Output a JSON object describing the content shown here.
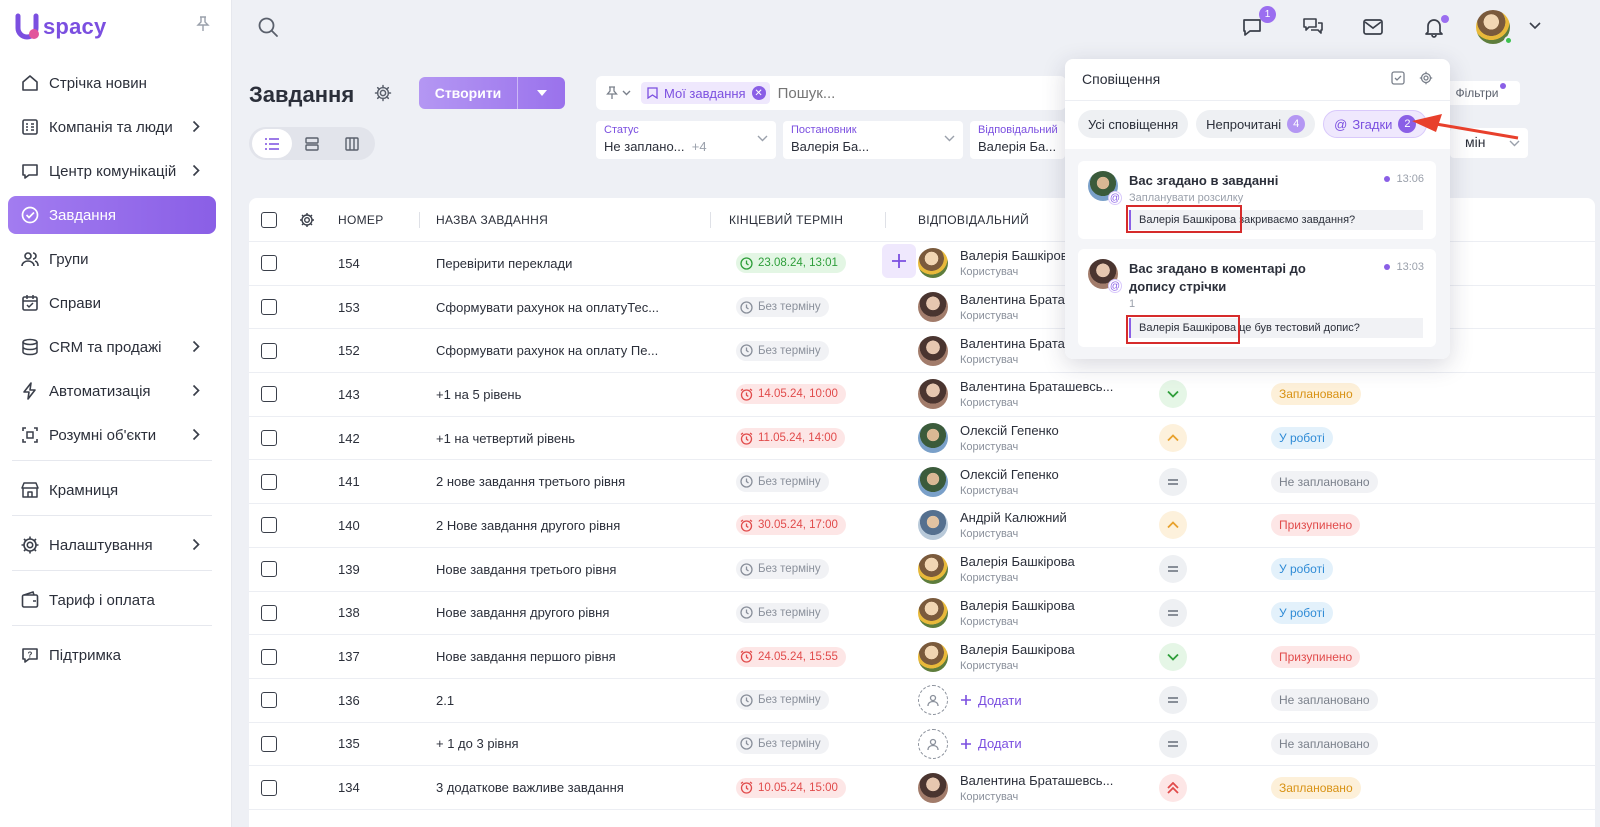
{
  "app": {
    "logo_letter": "U",
    "logo_text": "spacy"
  },
  "sidebar": {
    "items": [
      {
        "label": "Стрічка новин",
        "icon": "news-feed-icon"
      },
      {
        "label": "Компанія та люди",
        "icon": "company-icon",
        "chevron": true
      },
      {
        "label": "Центр комунікацій",
        "icon": "chat-icon",
        "chevron": true
      },
      {
        "label": "Завдання",
        "icon": "task-check-icon",
        "active": true
      },
      {
        "label": "Групи",
        "icon": "users-icon"
      },
      {
        "label": "Справи",
        "icon": "calendar-icon"
      },
      {
        "label": "CRM та продажі",
        "icon": "database-icon",
        "chevron": true
      },
      {
        "label": "Автоматизація",
        "icon": "lightning-icon",
        "chevron": true
      },
      {
        "label": "Розумні об'єкти",
        "icon": "smart-objects-icon",
        "chevron": true
      },
      {
        "label": "Крамниця",
        "icon": "store-icon"
      },
      {
        "label": "Налаштування",
        "icon": "gear-icon",
        "chevron": true
      },
      {
        "label": "Тариф і оплата",
        "icon": "wallet-icon"
      },
      {
        "label": "Підтримка",
        "icon": "help-icon"
      }
    ]
  },
  "topbar": {
    "chat_badge": "1"
  },
  "page": {
    "title": "Завдання",
    "create_label": "Створити"
  },
  "search": {
    "chip": "Мої завдання",
    "placeholder": "Пошук..."
  },
  "filters": {
    "status": {
      "label": "Статус",
      "value": "Не заплано...",
      "extra": "+4"
    },
    "creator": {
      "label": "Постановник",
      "value": "Валерія Ба..."
    },
    "responsible": {
      "label": "Відповідальний",
      "value": "Валерія Ба..."
    },
    "filters_button": "Фільтри",
    "hidden_value": "мін"
  },
  "table": {
    "headers": {
      "number": "НОМЕР",
      "name": "НАЗВА ЗАВДАННЯ",
      "deadline": "КІНЦЕВИЙ ТЕРМІН",
      "responsible": "ВІДПОВІДАЛЬНИЙ"
    },
    "role": "Користувач",
    "add_label": "Додати",
    "rows": [
      {
        "num": "154",
        "name": "Перевірити переклади",
        "deadline": "23.08.24, 13:01",
        "dl": "ok",
        "resp": "Валерія Башкірова",
        "av": "a",
        "prio": "",
        "status": "",
        "st": ""
      },
      {
        "num": "153",
        "name": "Сформувати рахунок на оплатуТес...",
        "deadline": "Без терміну",
        "dl": "none",
        "resp": "Валентина Брата",
        "av": "b",
        "prio": "",
        "status": "",
        "st": ""
      },
      {
        "num": "152",
        "name": "Сформувати рахунок на оплату Пе...",
        "deadline": "Без терміну",
        "dl": "none",
        "resp": "Валентина Брата",
        "av": "b",
        "prio": "",
        "status": "",
        "st": ""
      },
      {
        "num": "143",
        "name": "+1 на 5 рівень",
        "deadline": "14.05.24, 10:00",
        "dl": "over",
        "resp": "Валентина Браташевсь...",
        "av": "b",
        "prio": "low",
        "status": "Заплановано",
        "st": "plan"
      },
      {
        "num": "142",
        "name": "+1 на четвертий рівень",
        "deadline": "11.05.24, 14:00",
        "dl": "over",
        "resp": "Олексій Гепенко",
        "av": "c",
        "prio": "mid",
        "status": "У роботі",
        "st": "work"
      },
      {
        "num": "141",
        "name": "2 нове завдання третього рівня",
        "deadline": "Без терміну",
        "dl": "none",
        "resp": "Олексій Гепенко",
        "av": "c",
        "prio": "norm",
        "status": "Не заплановано",
        "st": "notplan"
      },
      {
        "num": "140",
        "name": "2 Нове завдання другого рівня",
        "deadline": "30.05.24, 17:00",
        "dl": "over",
        "resp": "Андрій Калюжний",
        "av": "d",
        "prio": "mid",
        "status": "Призупинено",
        "st": "pause"
      },
      {
        "num": "139",
        "name": "Нове завдання третього рівня",
        "deadline": "Без терміну",
        "dl": "none",
        "resp": "Валерія Башкірова",
        "av": "a",
        "prio": "norm",
        "status": "У роботі",
        "st": "work"
      },
      {
        "num": "138",
        "name": "Нове завдання другого рівня",
        "deadline": "Без терміну",
        "dl": "none",
        "resp": "Валерія Башкірова",
        "av": "a",
        "prio": "norm",
        "status": "У роботі",
        "st": "work"
      },
      {
        "num": "137",
        "name": "Нове завдання першого рівня",
        "deadline": "24.05.24, 15:55",
        "dl": "over",
        "resp": "Валерія Башкірова",
        "av": "a",
        "prio": "low",
        "status": "Призупинено",
        "st": "pause"
      },
      {
        "num": "136",
        "name": "2.1",
        "deadline": "Без терміну",
        "dl": "none",
        "resp": "",
        "av": "",
        "prio": "norm",
        "status": "Не заплановано",
        "st": "notplan"
      },
      {
        "num": "135",
        "name": "+ 1 до 3 рівня",
        "deadline": "Без терміну",
        "dl": "none",
        "resp": "",
        "av": "",
        "prio": "norm",
        "status": "Не заплановано",
        "st": "notplan"
      },
      {
        "num": "134",
        "name": "3 додаткове важливе завдання",
        "deadline": "10.05.24, 15:00",
        "dl": "over",
        "resp": "Валентина Браташевсь...",
        "av": "b",
        "prio": "high",
        "status": "Заплановано",
        "st": "plan"
      }
    ]
  },
  "notifications": {
    "title": "Сповіщення",
    "tabs": [
      {
        "label": "Усі сповіщення",
        "count": ""
      },
      {
        "label": "Непрочитані",
        "count": "4"
      },
      {
        "label": "Згадки",
        "count": "2",
        "selected": true
      }
    ],
    "items": [
      {
        "title": "Вас згадано в завданні",
        "time": "13:06",
        "sub": "Запланувати розсилку",
        "quote": "Валерія Башкірова закриваємо завдання?"
      },
      {
        "title": "Вас згадано в коментарі до допису стрічки",
        "time": "13:03",
        "sub": "1",
        "quote": "Валерія Башкірова це був тестовий допис?"
      }
    ]
  },
  "colors": {
    "accent": "#8a5fe6",
    "highlight": "#d62b2b"
  }
}
